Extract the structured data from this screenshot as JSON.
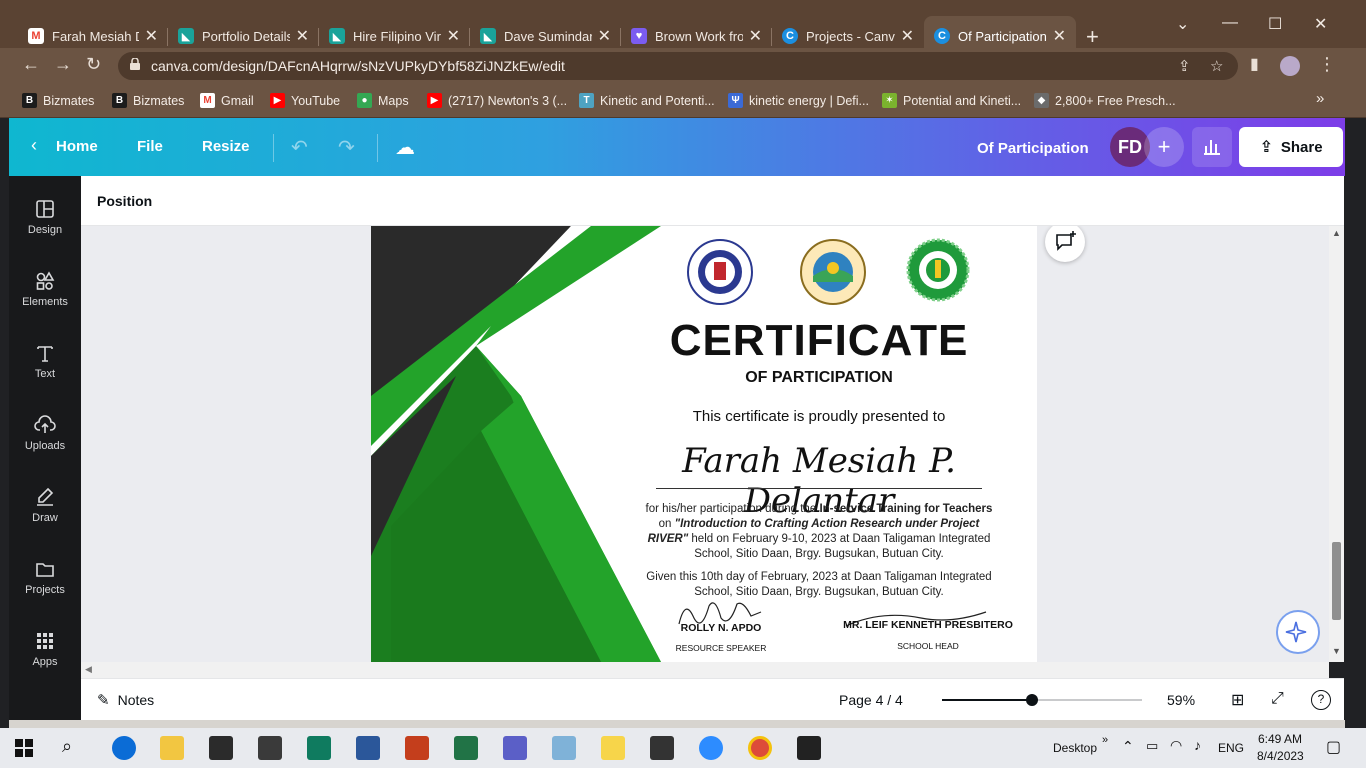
{
  "browser": {
    "tabs": [
      {
        "title": "Farah Mesiah De",
        "favicon": "gmail-icon",
        "color": "#ea4335"
      },
      {
        "title": "Portfolio Details",
        "favicon": "bizmates-icon",
        "color": "#1aa39a"
      },
      {
        "title": "Hire Filipino Virt",
        "favicon": "bizmates-icon",
        "color": "#1aa39a"
      },
      {
        "title": "Dave Sumindang",
        "favicon": "bizmates-icon",
        "color": "#1aa39a"
      },
      {
        "title": "Brown Work fro",
        "favicon": "heart-icon",
        "color": "#7b5cf0"
      },
      {
        "title": "Projects - Canva",
        "favicon": "canva-icon",
        "color": "#1b8fe0"
      },
      {
        "title": "Of Participation",
        "favicon": "canva-icon",
        "color": "#1b8fe0"
      }
    ],
    "url": "canva.com/design/DAFcnAHqrrw/sNzVUPkyDYbf58ZiJNZkEw/edit",
    "bookmarks": [
      {
        "label": "Bizmates",
        "icon": "B",
        "color": "#1c1c1c"
      },
      {
        "label": "Bizmates",
        "icon": "B",
        "color": "#1c1c1c"
      },
      {
        "label": "Gmail",
        "icon": "M",
        "color": "#ea4335"
      },
      {
        "label": "YouTube",
        "icon": "▶",
        "color": "#ff0000"
      },
      {
        "label": "Maps",
        "icon": "●",
        "color": "#34a853"
      },
      {
        "label": "(2717) Newton's 3 (...",
        "icon": "▶",
        "color": "#ff0000"
      },
      {
        "label": "Kinetic and Potenti...",
        "icon": "T",
        "color": "#4ea3c2"
      },
      {
        "label": "kinetic energy | Defi...",
        "icon": "Ψ",
        "color": "#3b6ad6"
      },
      {
        "label": "Potential and Kineti...",
        "icon": "✶",
        "color": "#7bb32e"
      },
      {
        "label": "2,800+ Free Presch...",
        "icon": "◆",
        "color": "#6b6b6b"
      }
    ],
    "more_bookmarks": "»"
  },
  "canva": {
    "home": "Home",
    "file": "File",
    "resize": "Resize",
    "design_title": "Of Participation",
    "avatar_initials": "FD",
    "share": "Share",
    "position": "Position",
    "rail": [
      {
        "label": "Design",
        "icon": "design-icon"
      },
      {
        "label": "Elements",
        "icon": "elements-icon"
      },
      {
        "label": "Text",
        "icon": "text-icon"
      },
      {
        "label": "Uploads",
        "icon": "uploads-icon"
      },
      {
        "label": "Draw",
        "icon": "draw-icon"
      },
      {
        "label": "Projects",
        "icon": "projects-icon"
      },
      {
        "label": "Apps",
        "icon": "apps-icon"
      }
    ],
    "notes": "Notes",
    "page": "Page 4 / 4",
    "zoom": "59%",
    "zoom_level": 0.45
  },
  "certificate": {
    "title": "CERTIFICATE",
    "subtitle": "OF PARTICIPATION",
    "presented": "This certificate is proudly presented to",
    "name": "Farah Mesiah P. Delantar",
    "body_1": "for his/her participation during the ",
    "body_bold": "In-service Training for Teachers",
    "body_2": " on ",
    "body_italic": "\"Introduction to Crafting Action Research under Project RIVER\"",
    "body_3": " held on February 9-10, 2023 at Daan Taligaman Integrated School, Sitio Daan, Brgy. Bugsukan, Butuan City.",
    "given": "Given this 10th day of February, 2023 at Daan Taligaman Integrated School, Sitio Daan, Brgy. Bugsukan, Butuan City.",
    "signer1_name": "ROLLY N. APDO",
    "signer1_role": "RESOURCE SPEAKER",
    "signer2_name": "MR. LEIF KENNETH PRESBITERO",
    "signer2_role": "SCHOOL HEAD",
    "seal1_text": "KAGAWARAN NG EDUKASYON",
    "colors": {
      "green": "#23a32a",
      "dark_green": "#1b7e1f",
      "dark": "#2a2a2a"
    }
  },
  "taskbar": {
    "desktop": "Desktop",
    "lang": "ENG",
    "time": "6:49 AM",
    "date": "8/4/2023"
  }
}
